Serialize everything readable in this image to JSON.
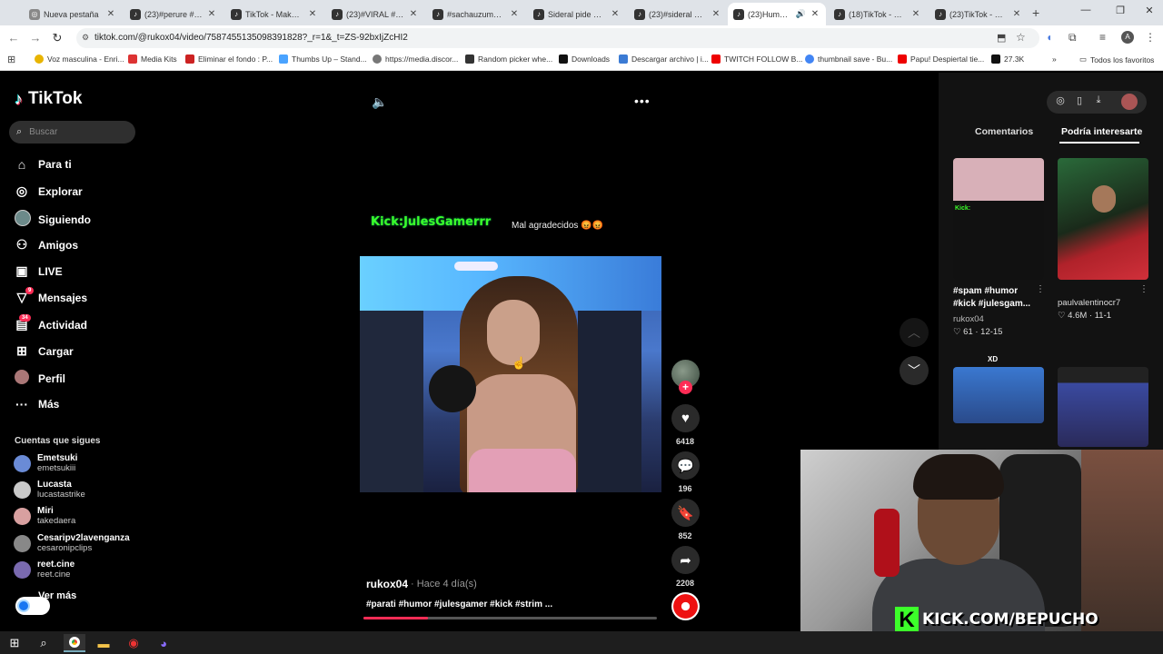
{
  "browser": {
    "tabs": [
      {
        "title": "Nueva pestaña",
        "icon": "globe-icon"
      },
      {
        "title": "(23)#perure #stre",
        "icon": "tiktok-icon"
      },
      {
        "title": "TikTok - Make Yo",
        "icon": "tiktok-icon"
      },
      {
        "title": "(23)#VIRAL #MET",
        "icon": "tiktok-icon"
      },
      {
        "title": "#sachauzumaki #",
        "icon": "tiktok-icon"
      },
      {
        "title": "Sideral pide al sis",
        "icon": "tiktok-icon"
      },
      {
        "title": "(23)#sideral #cha",
        "icon": "tiktok-icon"
      },
      {
        "title": "(23)Humor y",
        "icon": "tiktok-icon"
      },
      {
        "title": "(18)TikTok - Make",
        "icon": "tiktok-icon"
      },
      {
        "title": "(23)TikTok - Make",
        "icon": "tiktok-icon"
      }
    ],
    "new_tab": "+",
    "url": "tiktok.com/@rukox04/video/7587455135098391828?_r=1&_t=ZS-92bxIjZcHI2",
    "bookmarks": [
      {
        "label": "Voz masculina - Enri...",
        "color": "#e8b400"
      },
      {
        "label": "Media Kits",
        "color": "#d33"
      },
      {
        "label": "Eliminar el fondo : P...",
        "color": "#c22"
      },
      {
        "label": "Thumbs Up – Stand...",
        "color": "#4aa3ff"
      },
      {
        "label": "https://media.discor...",
        "color": "#777"
      },
      {
        "label": "Random picker whe...",
        "color": "#333"
      },
      {
        "label": "Downloads",
        "color": "#111"
      },
      {
        "label": "Descargar archivo | i...",
        "color": "#3b7bd4"
      },
      {
        "label": "TWITCH FOLLOW B...",
        "color": "#e00"
      },
      {
        "label": "thumbnail save - Bu...",
        "color": "#4285f4"
      },
      {
        "label": "Papu! Despiertal tie...",
        "color": "#e00"
      },
      {
        "label": "27.3K",
        "color": "#111"
      }
    ],
    "all_favorites": "Todos los favoritos"
  },
  "sidebar": {
    "brand": "TikTok",
    "search_placeholder": "Buscar",
    "nav": [
      {
        "label": "Para ti",
        "icon": "home-icon"
      },
      {
        "label": "Explorar",
        "icon": "compass-icon"
      },
      {
        "label": "Siguiendo",
        "icon": "following-avatar-icon"
      },
      {
        "label": "Amigos",
        "icon": "friends-icon"
      },
      {
        "label": "LIVE",
        "icon": "live-icon"
      },
      {
        "label": "Mensajes",
        "icon": "paper-plane-icon",
        "badge": "9"
      },
      {
        "label": "Actividad",
        "icon": "inbox-icon",
        "badge": "34"
      },
      {
        "label": "Cargar",
        "icon": "upload-icon"
      },
      {
        "label": "Perfil",
        "icon": "profile-avatar-icon"
      },
      {
        "label": "Más",
        "icon": "more-dots-icon"
      }
    ],
    "follows_title": "Cuentas que sigues",
    "follows": [
      {
        "name": "Emetsuki",
        "handle": "emetsukiii",
        "color": "#6a8bd6"
      },
      {
        "name": "Lucasta",
        "handle": "lucastastrike",
        "color": "#c9c9c9"
      },
      {
        "name": "Miri",
        "handle": "takedaera",
        "color": "#d8a0a0"
      },
      {
        "name": "Cesaripv2lavenganza",
        "handle": "cesaronipclips",
        "color": "#888"
      },
      {
        "name": "reet.cine",
        "handle": "reet.cine",
        "color": "#7a6ab0"
      }
    ],
    "see_more": "Ver más"
  },
  "video": {
    "overlay_kick": "Kick:JulesGamerrr",
    "overlay_caption": "Mal agradecidos 😡😡",
    "author": "rukox04",
    "posted": "· Hace 4 día(s)",
    "tags": "#parati #humor #julesgamer #kick #strim ...",
    "progress": 0.22,
    "likes": "6418",
    "comments": "196",
    "saves": "852",
    "shares": "2208"
  },
  "right_panel": {
    "tab_comments": "Comentarios",
    "tab_suggested": "Podría interesarte",
    "items": [
      {
        "caption": "#spam #humor #kick #julesgam...",
        "author": "rukox04",
        "stats": "♡ 61 · 12-15"
      },
      {
        "caption": "paulvalentinocr7",
        "author": "",
        "stats": "♡ 4.6M · 11-1"
      }
    ],
    "thumb3_label": "XD"
  },
  "webcam": {
    "k": "K",
    "url": "KICK.COM/BEPUCHO"
  }
}
